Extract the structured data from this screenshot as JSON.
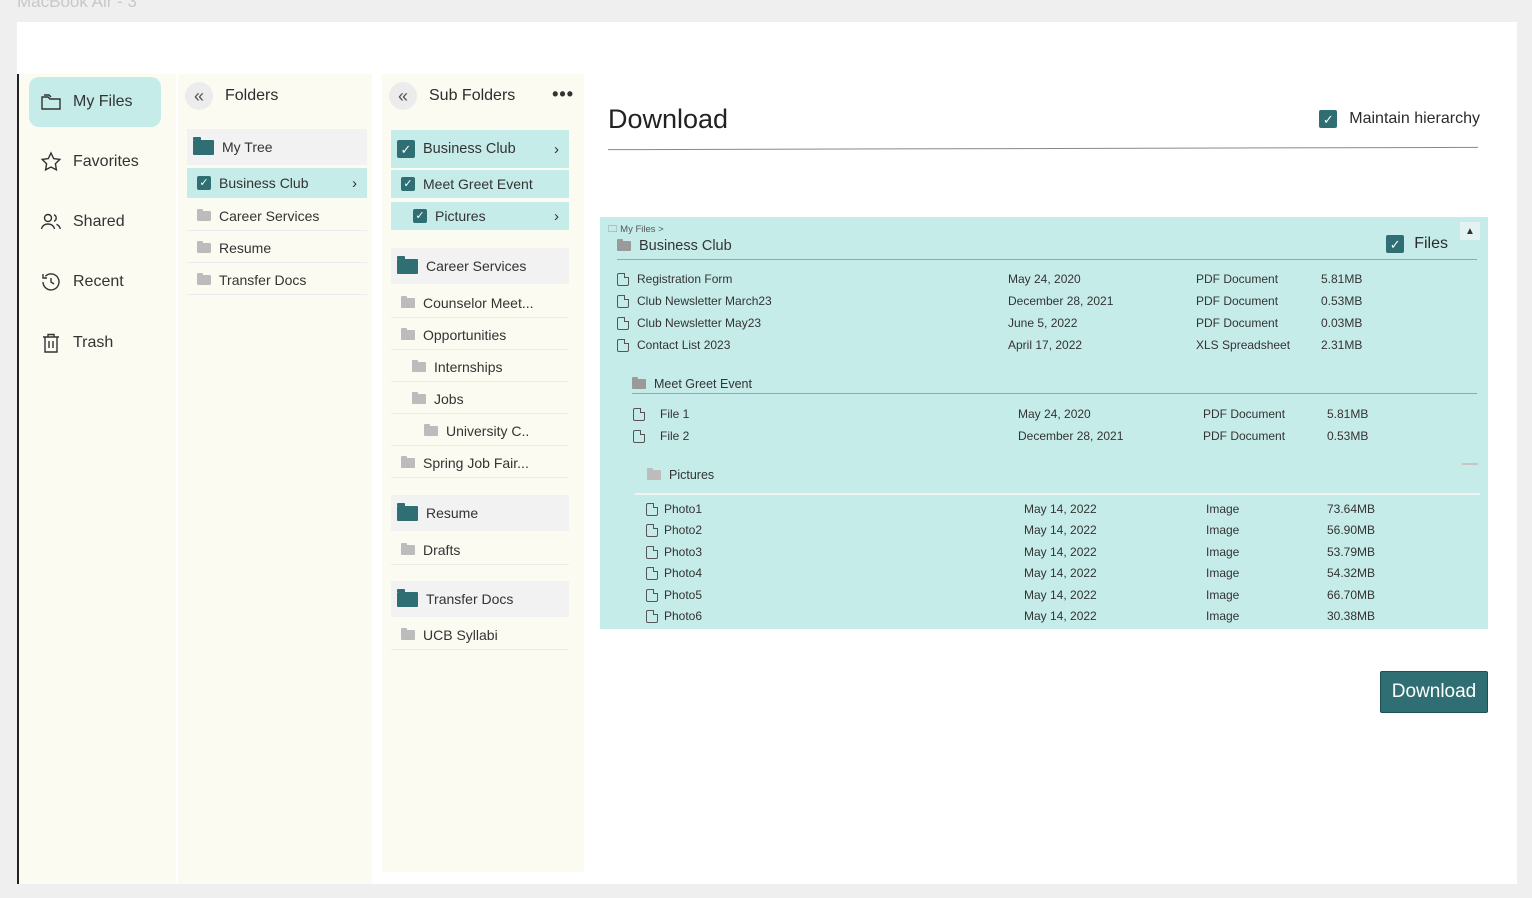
{
  "window": {
    "frame_label": "MacBook Air - 3"
  },
  "nav": {
    "items": [
      {
        "label": "My Files",
        "icon": "folder-icon",
        "active": true
      },
      {
        "label": "Favorites",
        "icon": "star-icon"
      },
      {
        "label": "Shared",
        "icon": "users-icon"
      },
      {
        "label": "Recent",
        "icon": "history-icon"
      },
      {
        "label": "Trash",
        "icon": "trash-icon"
      }
    ]
  },
  "folders": {
    "title": "Folders",
    "items": [
      {
        "label": "My Tree"
      },
      {
        "label": "Business Club",
        "checked": true
      },
      {
        "label": "Career Services"
      },
      {
        "label": "Resume"
      },
      {
        "label": "Transfer Docs"
      }
    ]
  },
  "subfolders": {
    "title": "Sub Folders",
    "more_icon": "ellipsis-icon",
    "items": [
      {
        "label": "Business Club"
      },
      {
        "label": "Meet Greet Event"
      },
      {
        "label": "Pictures"
      },
      {
        "label": "Career Services"
      },
      {
        "label": "Counselor Meet..."
      },
      {
        "label": "Opportunities"
      },
      {
        "label": "Internships"
      },
      {
        "label": "Jobs"
      },
      {
        "label": "University C.."
      },
      {
        "label": "Spring Job Fair..."
      },
      {
        "label": "Resume"
      },
      {
        "label": "Drafts"
      },
      {
        "label": "Transfer Docs"
      },
      {
        "label": "UCB Syllabi"
      }
    ]
  },
  "main": {
    "title": "Download",
    "maintain_hierarchy": "Maintain hierarchy",
    "download_button": "Download"
  },
  "panel": {
    "breadcrumb": "My Files >",
    "section_title": "Business Club",
    "files_toggle": "Files",
    "files": [
      {
        "name": "Registration Form",
        "date": "May 24, 2020",
        "type": "PDF Document",
        "size": "5.81MB"
      },
      {
        "name": "Club Newsletter March23",
        "date": "December 28, 2021",
        "type": "PDF Document",
        "size": "0.53MB"
      },
      {
        "name": "Club Newsletter May23",
        "date": "June 5, 2022",
        "type": "PDF Document",
        "size": "0.03MB"
      },
      {
        "name": "Contact List 2023",
        "date": "April 17, 2022",
        "type": "XLS Spreadsheet",
        "size": "2.31MB"
      }
    ],
    "sub1_title": "Meet Greet Event",
    "sub1_files": [
      {
        "name": "File 1",
        "date": "May 24, 2020",
        "type": "PDF Document",
        "size": "5.81MB"
      },
      {
        "name": "File 2",
        "date": "December 28, 2021",
        "type": "PDF Document",
        "size": "0.53MB"
      }
    ],
    "sub2_title": "Pictures",
    "sub2_files": [
      {
        "name": "Photo1",
        "date": "May 14, 2022",
        "type": "Image",
        "size": "73.64MB"
      },
      {
        "name": "Photo2",
        "date": "May 14, 2022",
        "type": "Image",
        "size": "56.90MB"
      },
      {
        "name": "Photo3",
        "date": "May 14, 2022",
        "type": "Image",
        "size": "53.79MB"
      },
      {
        "name": "Photo4",
        "date": "May 14, 2022",
        "type": "Image",
        "size": "54.32MB"
      },
      {
        "name": "Photo5",
        "date": "May 14, 2022",
        "type": "Image",
        "size": "66.70MB"
      },
      {
        "name": "Photo6",
        "date": "May 14, 2022",
        "type": "Image",
        "size": "30.38MB"
      }
    ]
  },
  "colors": {
    "accent": "#2f6f73",
    "selection": "#c6ecea",
    "sidebar_bg": "#fcfbf2"
  }
}
